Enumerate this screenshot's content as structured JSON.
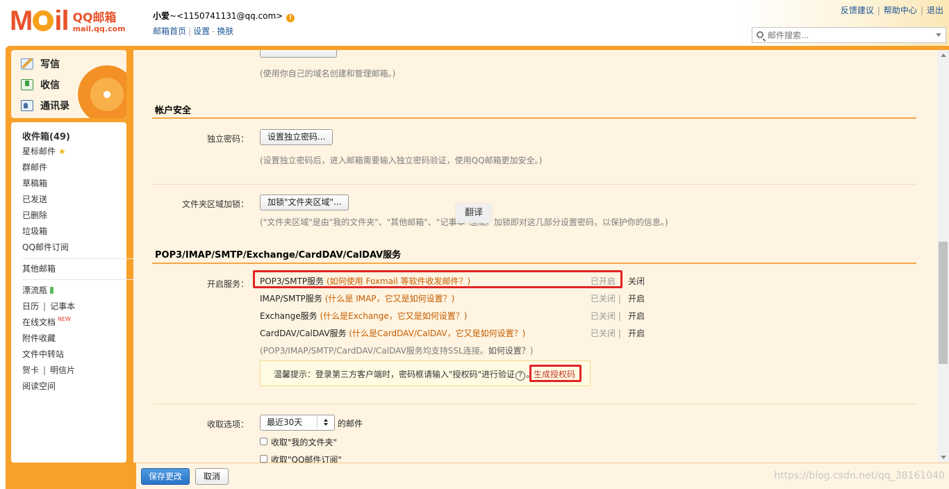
{
  "logo": {
    "big": "MOil",
    "brand": "QQ邮箱",
    "url": "mail.qq.com"
  },
  "user": {
    "name": "小爱",
    "email": "~<1150741131@qq.com>",
    "warn": "!"
  },
  "user_links": {
    "home": "邮箱首页",
    "settings": "设置",
    "skin": "换肤",
    "sep": "|",
    "dash": "-"
  },
  "top_links": {
    "feedback": "反馈建议",
    "help": "帮助中心",
    "logout": "退出",
    "sep": "|"
  },
  "search": {
    "placeholder": "邮件搜索..."
  },
  "quick": {
    "write": "写信",
    "receive": "收信",
    "contacts": "通讯录"
  },
  "folders": {
    "inbox": "收件箱(49)",
    "starred": "星标邮件",
    "group": "群邮件",
    "drafts": "草稿箱",
    "sent": "已发送",
    "deleted": "已删除",
    "spam": "垃圾箱",
    "subscribe": "QQ邮件订阅",
    "other": "其他邮箱",
    "bottle": "漂流瓶",
    "calendar": "日历",
    "notes": "记事本",
    "docs": "在线文档",
    "docs_badge": "NEW",
    "attachments": "附件收藏",
    "transfer": "文件中转站",
    "cards": "贺卡",
    "postcards": "明信片",
    "reading": "阅读空间",
    "sep": "|"
  },
  "main": {
    "domain_hint": "(使用你自己的域名创建和管理邮箱。)",
    "security_title": "帐户安全",
    "pwd_label": "独立密码：",
    "pwd_button": "设置独立密码...",
    "pwd_hint": "(设置独立密码后，进入邮箱需要输入独立密码验证，使用QQ邮箱更加安全。)",
    "lock_label": "文件夹区域加锁：",
    "lock_button": "加锁\"文件夹区域\"...",
    "lock_hint": "(\"文件夹区域\"是由\"我的文件夹\"、\"其他邮箱\"、\"记事本\"组成。加锁即对这几部分设置密码，以保护你的信息。)",
    "translate_popup": "翻译",
    "service_title": "POP3/IMAP/SMTP/Exchange/CardDAV/CalDAV服务",
    "enable_label": "开启服务：",
    "services": [
      {
        "name": "POP3/SMTP服务",
        "link": "(如何使用 Foxmail 等软件收发邮件？)",
        "status": "已开启",
        "action": "关闭"
      },
      {
        "name": "IMAP/SMTP服务",
        "link": "(什么是 IMAP，它又是如何设置？)",
        "status": "已关闭",
        "action": "开启"
      },
      {
        "name": "Exchange服务",
        "link": "(什么是Exchange，它又是如何设置？)",
        "status": "已关闭",
        "action": "开启"
      },
      {
        "name": "CardDAV/CalDAV服务",
        "link": "(什么是CardDAV/CalDAV，它又是如何设置？)",
        "status": "已关闭",
        "action": "开启"
      }
    ],
    "status_sep": "|",
    "ssl_hint_a": "(POP3/IMAP/SMTP/CardDAV/CalDAV服务均支持SSL连接。",
    "ssl_hint_link": "如何设置？",
    "ssl_hint_b": ")",
    "tip_text": "温馨提示：登录第三方客户端时，密码框请输入\"授权码\"进行验证",
    "tip_q": "?",
    "tip_dot": "。",
    "gen_code": "生成授权码",
    "fetch_label": "收取选项：",
    "fetch_select": "最近30天",
    "fetch_suffix": "的邮件",
    "fetch_folders": "收取\"我的文件夹\"",
    "fetch_subscribe": "收取\"QQ邮件订阅\""
  },
  "bottom": {
    "save": "保存更改",
    "cancel": "取消",
    "watermark": "https://blog.csdn.net/qq_38161040"
  },
  "colors": {
    "accent": "#f7a02a",
    "highlight": "#e02424",
    "link": "#1e5494",
    "primary_button": "#2a73c8"
  }
}
